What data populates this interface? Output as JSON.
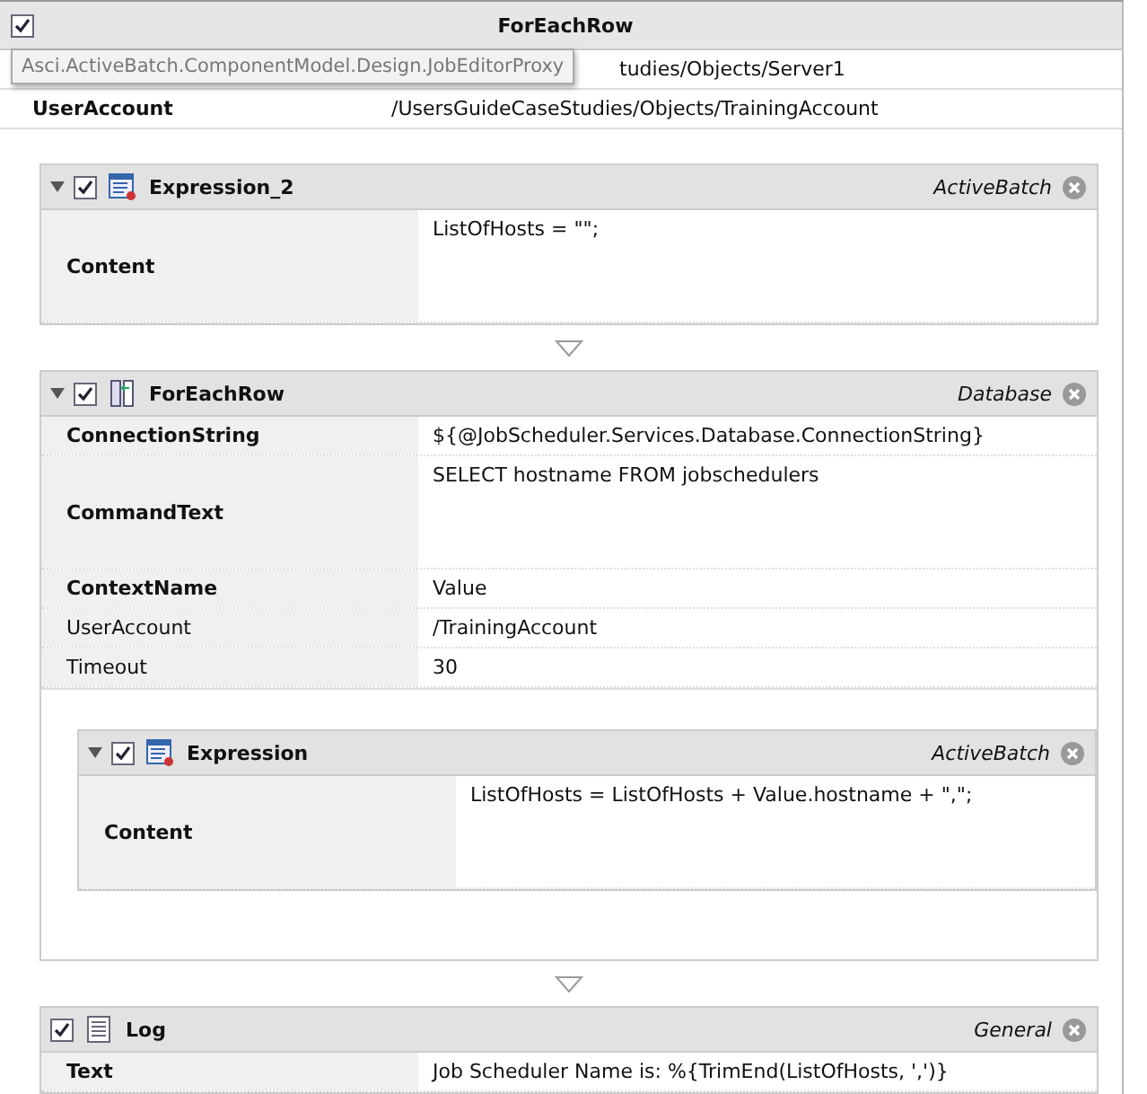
{
  "header": {
    "title": "ForEachRow",
    "checked": true
  },
  "tooltip": "Asci.ActiveBatch.ComponentModel.Design.JobEditorProxy",
  "properties": [
    {
      "value": "tudies/Objects/Server1"
    },
    {
      "label": "UserAccount",
      "value": "/UsersGuideCaseStudies/Objects/TrainingAccount",
      "bold": true
    }
  ],
  "activities": [
    {
      "kind": "expression",
      "title": "Expression_2",
      "category": "ActiveBatch",
      "checked": true,
      "expanded": true,
      "properties": [
        {
          "label": "Content",
          "value": "ListOfHosts = \"\";",
          "bold": true,
          "tall": true
        }
      ]
    },
    {
      "kind": "loop",
      "title": "ForEachRow",
      "category": "Database",
      "checked": true,
      "expanded": true,
      "properties": [
        {
          "label": "ConnectionString",
          "value": "${@JobScheduler.Services.Database.ConnectionString}",
          "bold": true,
          "tall": false
        },
        {
          "label": "CommandText",
          "value": "SELECT hostname FROM jobschedulers",
          "bold": true,
          "tall": true
        },
        {
          "label": "ContextName",
          "value": "Value",
          "bold": true,
          "tall": false
        },
        {
          "label": "UserAccount",
          "value": "/TrainingAccount",
          "bold": false,
          "tall": false
        },
        {
          "label": "Timeout",
          "value": "30",
          "bold": false,
          "tall": false
        }
      ],
      "children": [
        {
          "kind": "expression",
          "title": "Expression",
          "category": "ActiveBatch",
          "checked": true,
          "expanded": true,
          "properties": [
            {
              "label": "Content",
              "value": "ListOfHosts = ListOfHosts + Value.hostname + \",\";",
              "bold": true,
              "tall": true
            }
          ]
        }
      ]
    },
    {
      "kind": "log",
      "title": "Log",
      "category": "General",
      "checked": true,
      "expanded": false,
      "properties": [
        {
          "label": "Text",
          "value": "Job Scheduler Name is: %{TrimEnd(ListOfHosts, ',')}",
          "bold": true,
          "tall": false
        }
      ]
    }
  ]
}
